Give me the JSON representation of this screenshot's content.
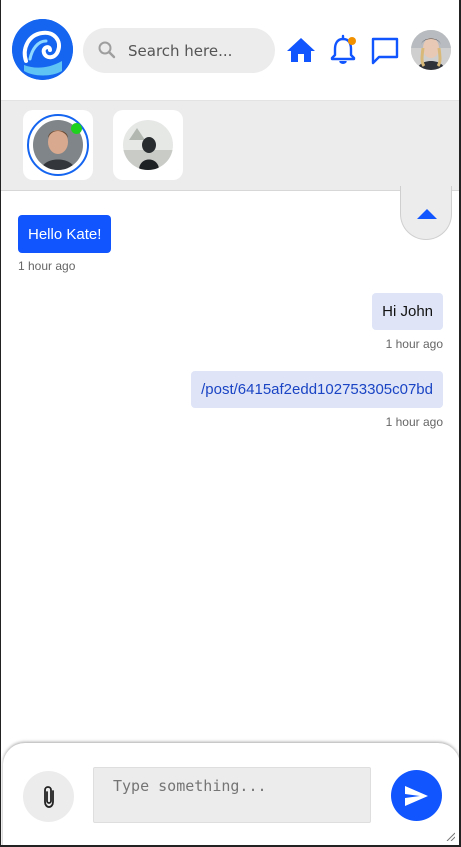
{
  "colors": {
    "accent": "#1155ff",
    "brand_blue": "#1565f0",
    "surface_grey": "#ececec",
    "bubble_out": "#dfe5f7",
    "notification_dot": "#f29100",
    "online": "#1fd11f"
  },
  "header": {
    "logo_icon": "wave-logo-icon",
    "search": {
      "placeholder": "Search here..."
    },
    "nav_icons": [
      "home-icon",
      "bell-icon",
      "chat-icon"
    ],
    "notification_badge": true,
    "profile_avatar": "user-avatar"
  },
  "contacts": [
    {
      "name": "contact-john",
      "active": true,
      "online": true
    },
    {
      "name": "contact-second",
      "active": false,
      "online": false
    }
  ],
  "messages": [
    {
      "direction": "incoming",
      "text": "Hello Kate!",
      "time": "1 hour ago"
    },
    {
      "direction": "outgoing",
      "text": "Hi John",
      "time": "1 hour ago"
    },
    {
      "direction": "outgoing",
      "text": "/post/6415af2edd102753305c07bd",
      "time": "1 hour ago",
      "is_link": true
    }
  ],
  "composer": {
    "placeholder": "Type something...",
    "attach_icon": "paperclip-icon",
    "send_icon": "send-icon"
  }
}
